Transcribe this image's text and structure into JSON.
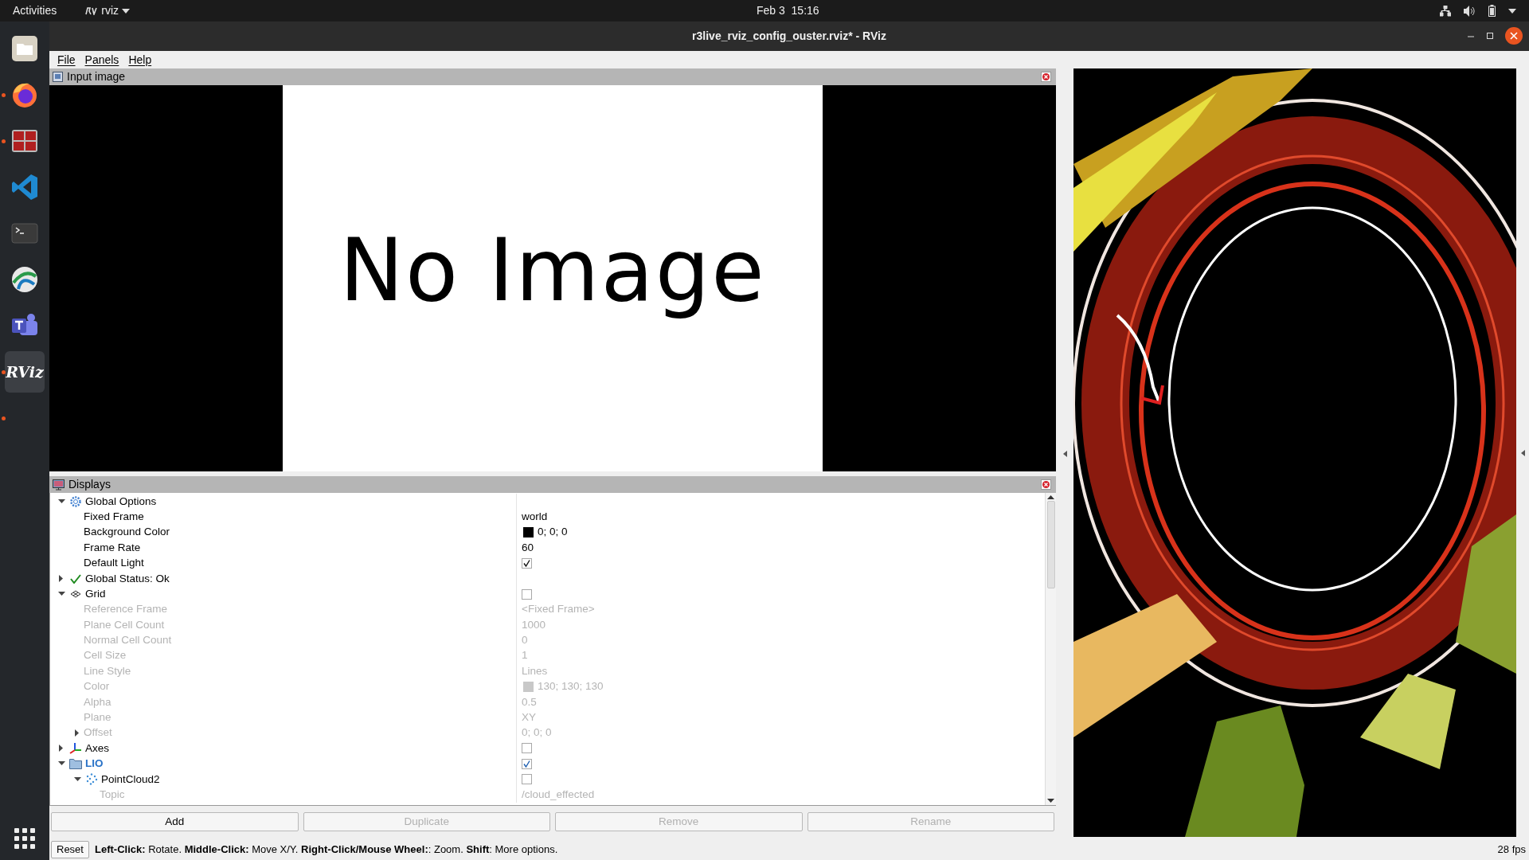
{
  "top_bar": {
    "activities": "Activities",
    "app_menu": "rviz",
    "clock": "Feb 3  15:16"
  },
  "dock": [
    {
      "kind": "files",
      "running": false,
      "selected": false
    },
    {
      "kind": "firefox",
      "running": true,
      "selected": false
    },
    {
      "kind": "terminator",
      "running": true,
      "selected": false
    },
    {
      "kind": "vscode",
      "running": false,
      "selected": false
    },
    {
      "kind": "terminal",
      "running": false,
      "selected": false
    },
    {
      "kind": "globe",
      "running": false,
      "selected": false
    },
    {
      "kind": "teams",
      "running": false,
      "selected": false
    },
    {
      "kind": "rviz",
      "running": true,
      "selected": true,
      "label": "RViz"
    },
    {
      "kind": "blank",
      "running": true,
      "selected": false
    }
  ],
  "window": {
    "title": "r3live_rviz_config_ouster.rviz* - RViz"
  },
  "menu": [
    "File",
    "Panels",
    "Help"
  ],
  "image_panel": {
    "title": "Input image",
    "message": "No Image"
  },
  "displays": {
    "title": "Displays",
    "tree": [
      {
        "label": "Global Options",
        "kind": "gear",
        "disabled": false,
        "expanded": true,
        "children": [
          {
            "label": "Fixed Frame",
            "kind": "property",
            "disabled": false,
            "value": "world"
          },
          {
            "label": "Background Color",
            "kind": "property",
            "disabled": false,
            "value": "0; 0; 0",
            "color": "#000000"
          },
          {
            "label": "Frame Rate",
            "kind": "property",
            "disabled": false,
            "value": "60"
          },
          {
            "label": "Default Light",
            "kind": "property",
            "disabled": false,
            "checked": true
          }
        ]
      },
      {
        "label": "Global Status: Ok",
        "kind": "status",
        "disabled": false,
        "expanded": false
      },
      {
        "label": "Grid",
        "kind": "grid",
        "disabled": false,
        "expanded": true,
        "checked": false,
        "children": [
          {
            "label": "Reference Frame",
            "kind": "property",
            "disabled": true,
            "value": "<Fixed Frame>"
          },
          {
            "label": "Plane Cell Count",
            "kind": "property",
            "disabled": true,
            "value": "1000"
          },
          {
            "label": "Normal Cell Count",
            "kind": "property",
            "disabled": true,
            "value": "0"
          },
          {
            "label": "Cell Size",
            "kind": "property",
            "disabled": true,
            "value": "1"
          },
          {
            "label": "Line Style",
            "kind": "property",
            "disabled": true,
            "value": "Lines"
          },
          {
            "label": "Color",
            "kind": "property",
            "disabled": true,
            "value": "130; 130; 130",
            "color": "#c8c8c8"
          },
          {
            "label": "Alpha",
            "kind": "property",
            "disabled": true,
            "value": "0.5"
          },
          {
            "label": "Plane",
            "kind": "property",
            "disabled": true,
            "value": "XY"
          },
          {
            "label": "Offset",
            "kind": "property",
            "disabled": true,
            "value": "0; 0; 0",
            "expanded": false
          }
        ]
      },
      {
        "label": "Axes",
        "kind": "axes",
        "disabled": false,
        "expanded": false,
        "checked": false
      },
      {
        "label": "LIO",
        "kind": "folder",
        "disabled": false,
        "expanded": true,
        "checked": true,
        "children": [
          {
            "label": "PointCloud2",
            "kind": "cloud",
            "disabled": false,
            "expanded": true,
            "checked": false,
            "children": [
              {
                "label": "Topic",
                "kind": "property",
                "disabled": true,
                "value": "/cloud_effected"
              }
            ]
          }
        ]
      }
    ]
  },
  "buttons": [
    {
      "label": "Add",
      "disabled": false
    },
    {
      "label": "Duplicate",
      "disabled": true
    },
    {
      "label": "Remove",
      "disabled": true
    },
    {
      "label": "Rename",
      "disabled": true
    }
  ],
  "status_bar": {
    "reset": "Reset",
    "hint": "**Left-Click:** Rotate. **Middle-Click:** Move X/Y. **Right-Click/Mouse Wheel:**: Zoom. **Shift**: More options.",
    "fps": "28 fps"
  }
}
